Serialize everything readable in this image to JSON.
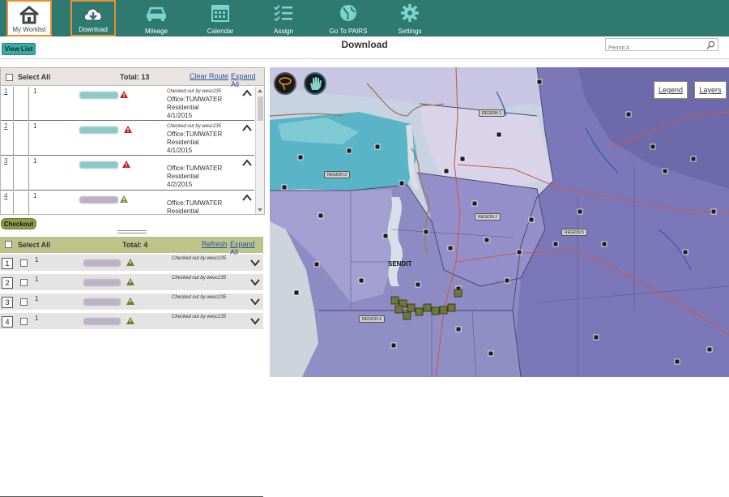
{
  "nav": {
    "items": [
      {
        "label": "My Worklist",
        "icon": "home-icon"
      },
      {
        "label": "Download",
        "icon": "cloud-download-icon"
      },
      {
        "label": "Mileage",
        "icon": "car-icon"
      },
      {
        "label": "Calendar",
        "icon": "calendar-icon"
      },
      {
        "label": "Assign",
        "icon": "checklist-icon"
      },
      {
        "label": "Go To PAIRS",
        "icon": "globe-icon"
      },
      {
        "label": "Settings",
        "icon": "gear-icon"
      }
    ]
  },
  "header": {
    "view_list_label": "View List",
    "title": "Download",
    "search_placeholder": "Permit #"
  },
  "list1": {
    "select_all_label": "Select All",
    "total_label": "Total:  13",
    "clear_route_label": "Clear Route",
    "expand_all_label": "Expand All",
    "rows": [
      {
        "num": "1",
        "qty": "1",
        "checked_out": "Checked out by  wesc235",
        "office": "Office:TUMWATER",
        "type": "Residential",
        "date": "4/1/2015"
      },
      {
        "num": "2",
        "qty": "1",
        "checked_out": "Checked out by  wesc235",
        "office": "Office:TUMWATER",
        "type": "Residential",
        "date": "4/1/2015"
      },
      {
        "num": "3",
        "qty": "1",
        "checked_out": "",
        "office": "Office:TUMWATER",
        "type": "Residential",
        "date": "4/2/2015"
      },
      {
        "num": "4",
        "qty": "1",
        "checked_out": "",
        "office": "Office:TUMWATER",
        "type": "Residential",
        "date": ""
      }
    ]
  },
  "checkout_label": "Checkout",
  "list2": {
    "select_all_label": "Select All",
    "total_label": "Total:  4",
    "refresh_label": "Refresh",
    "expand_all_label": "Expand All",
    "rows": [
      {
        "num": "1",
        "qty": "1",
        "checked_out": "Checked out by  wesc235"
      },
      {
        "num": "2",
        "qty": "1",
        "checked_out": "Checked out by  wesc235"
      },
      {
        "num": "3",
        "qty": "1",
        "checked_out": "Checked out by  wesc235"
      },
      {
        "num": "4",
        "qty": "1",
        "checked_out": "Checked out by  wesc235"
      }
    ]
  },
  "map": {
    "legend_label": "Legend",
    "layers_label": "Layers",
    "regions": [
      "REGION 1",
      "REGION 2",
      "REGION 3",
      "REGION 4",
      "REGION 5"
    ],
    "sendit_label": "SENDIT"
  },
  "colors": {
    "nav_bg": "#2e7a71",
    "accent_orange": "#e8912a",
    "button_teal": "#39a9a3",
    "checkout_olive": "#8d9a47",
    "list2_header": "#bcc48a"
  }
}
